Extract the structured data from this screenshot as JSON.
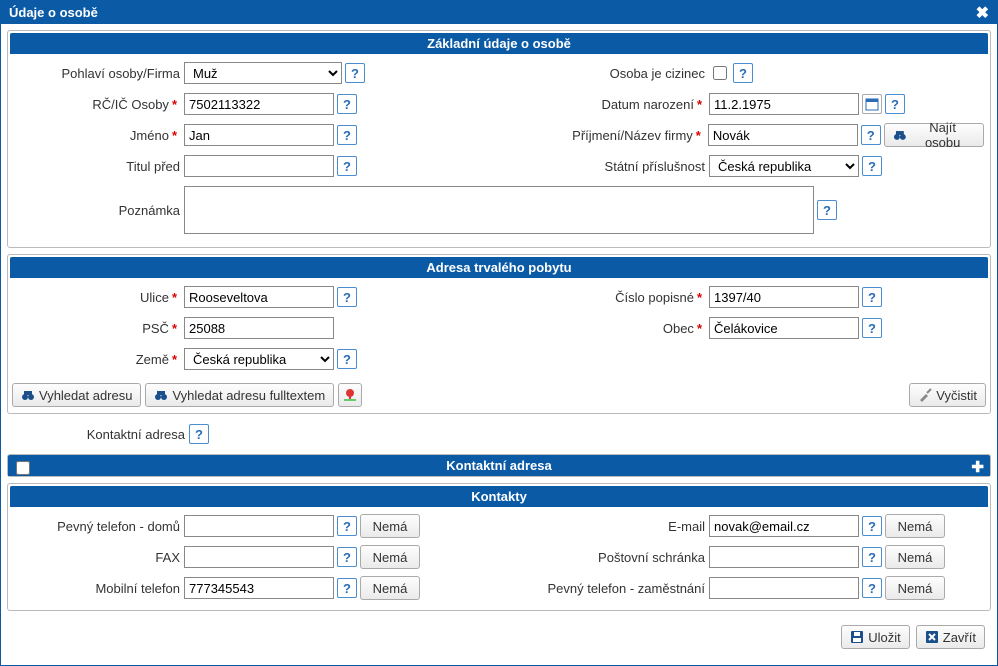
{
  "dialog": {
    "title": "Údaje o osobě"
  },
  "basic": {
    "head": "Základní údaje o osobě",
    "gender_lbl": "Pohlaví osoby/Firma",
    "gender_val": "Muž",
    "foreigner_lbl": "Osoba je cizinec",
    "rc_lbl": "RČ/IČ Osoby",
    "rc_val": "7502113322",
    "dob_lbl": "Datum narození",
    "dob_val": "11.2.1975",
    "fname_lbl": "Jméno",
    "fname_val": "Jan",
    "lname_lbl": "Příjmení/Název firmy",
    "lname_val": "Novák",
    "find_person": "Najít osobu",
    "title_lbl": "Titul před",
    "title_val": "",
    "nat_lbl": "Státní příslušnost",
    "nat_val": "Česká republika",
    "note_lbl": "Poznámka",
    "note_val": ""
  },
  "addr": {
    "head": "Adresa trvalého pobytu",
    "street_lbl": "Ulice",
    "street_val": "Rooseveltova",
    "houseno_lbl": "Číslo popisné",
    "houseno_val": "1397/40",
    "zip_lbl": "PSČ",
    "zip_val": "25088",
    "city_lbl": "Obec",
    "city_val": "Čelákovice",
    "country_lbl": "Země",
    "country_val": "Česká republika",
    "find_addr": "Vyhledat adresu",
    "find_addr_full": "Vyhledat adresu fulltextem",
    "clear": "Vyčistit",
    "contact_addr_lbl": "Kontaktní adresa"
  },
  "contact_addr_section": {
    "head": "Kontaktní adresa"
  },
  "contacts": {
    "head": "Kontakty",
    "phone_home_lbl": "Pevný telefon - domů",
    "phone_home_val": "",
    "email_lbl": "E-mail",
    "email_val": "novak@email.cz",
    "fax_lbl": "FAX",
    "fax_val": "",
    "pobox_lbl": "Poštovní schránka",
    "pobox_val": "",
    "mobile_lbl": "Mobilní telefon",
    "mobile_val": "777345543",
    "phone_work_lbl": "Pevný telefon - zaměstnání",
    "phone_work_val": "",
    "nema": "Nemá"
  },
  "footer": {
    "save": "Uložit",
    "close": "Zavřít"
  }
}
